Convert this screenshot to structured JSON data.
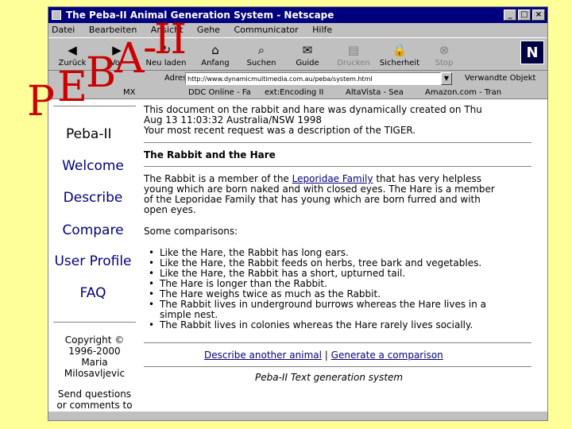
{
  "slide": {
    "overlay_title": "PEBA-II"
  },
  "browser": {
    "title": "The Peba-II Animal Generation System - Netscape",
    "window_controls": [
      "_",
      "□",
      "×"
    ],
    "menu": [
      "Datei",
      "Bearbeiten",
      "Ansicht",
      "Gehe",
      "Communicator",
      "Hilfe"
    ],
    "toolbar": [
      {
        "label": "Zurück",
        "icon": "back-arrow-icon"
      },
      {
        "label": "Vor",
        "icon": "forward-arrow-icon"
      },
      {
        "label": "Neu laden",
        "icon": "reload-icon"
      },
      {
        "label": "Anfang",
        "icon": "home-icon"
      },
      {
        "label": "Suchen",
        "icon": "search-icon"
      },
      {
        "label": "Guide",
        "icon": "guide-icon"
      },
      {
        "label": "Drucken",
        "icon": "print-icon"
      },
      {
        "label": "Sicherheit",
        "icon": "lock-icon"
      },
      {
        "label": "Stop",
        "icon": "stop-icon"
      }
    ],
    "address": {
      "label": "Adresse:",
      "url": "http://www.dynamicmultimedia.com.au/peba/system.html",
      "related": "Verwandte Objekt"
    },
    "links": [
      "MX",
      "DDC Online - Fa",
      "ext:Encoding II",
      "AltaVista - Sea",
      "Amazon.com - Tran"
    ],
    "colors": {
      "titlebar": "#00007f",
      "chrome": "#c0c0c0",
      "link": "#00007f",
      "overlay": "#cc0000",
      "slide_bg": "#ffff99"
    }
  },
  "sidebar": {
    "title": "Peba-II",
    "links": [
      "Welcome",
      "Describe",
      "Compare",
      "User Profile",
      "FAQ"
    ],
    "copyright": [
      "Copyright ©",
      "1996-2000",
      "Maria",
      "Milosavljevic"
    ],
    "send_questions": [
      "Send questions",
      "or comments to"
    ]
  },
  "main": {
    "intro": [
      "This document on the rabbit and hare was dynamically created on Thu",
      "Aug 13 11:03:32 Australia/NSW 1998",
      "Your most recent request was a description of the TIGER."
    ],
    "heading": "The Rabbit and the Hare",
    "desc_parts": [
      "The Rabbit is a member of the ",
      "Leporidae Family",
      " that has very helpless"
    ],
    "desc_lines": [
      "young which are born naked and with closed eyes. The Hare is a member",
      "of the Leporidae Family that has young which are born furred and with",
      "open eyes."
    ],
    "comparisons_label": "Some comparisons:",
    "comparisons": [
      "Like the Hare, the Rabbit has long ears.",
      "Like the Hare, the Rabbit feeds on herbs, tree bark and vegetables.",
      "Like the Hare, the Rabbit has a short, upturned tail.",
      "The Hare is longer than the Rabbit.",
      "The Hare weighs twice as much as the Rabbit.",
      "The Rabbit lives in underground burrows whereas the Hare lives in a",
      "simple nest.",
      "The Rabbit lives in colonies whereas the Hare rarely lives socially."
    ],
    "action_links": [
      "Describe another animal",
      "|",
      "Generate a comparison"
    ],
    "footer": "Peba-II Text generation system"
  }
}
